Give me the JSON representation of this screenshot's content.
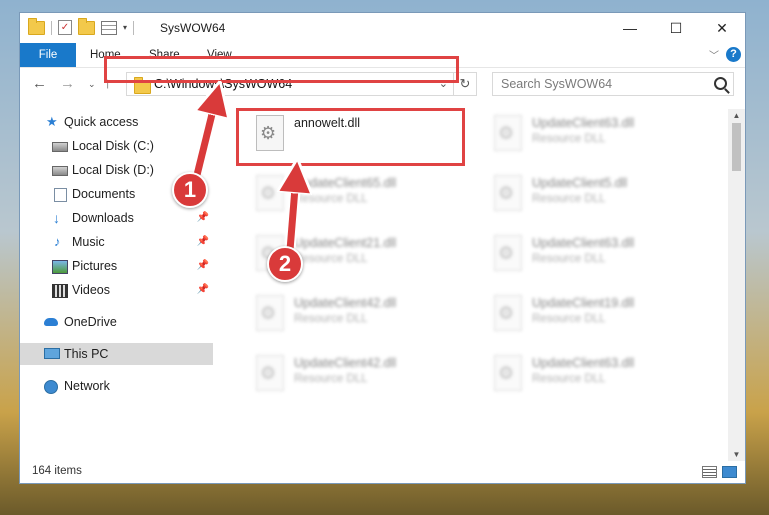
{
  "window": {
    "title": "SysWOW64",
    "controls": {
      "minimize": "—",
      "maximize": "☐",
      "close": "✕"
    }
  },
  "ribbon": {
    "tabs": [
      {
        "label": "File"
      },
      {
        "label": "Home"
      },
      {
        "label": "Share"
      },
      {
        "label": "View"
      }
    ],
    "help": "?"
  },
  "navigation": {
    "back": "←",
    "forward": "→",
    "recent": "⌄",
    "up": "↑",
    "address": "C:\\Windows\\SysWOW64",
    "address_dropdown": "⌄",
    "refresh": "↻",
    "search_placeholder": "Search SysWOW64"
  },
  "sidebar": {
    "items": [
      {
        "label": "Quick access",
        "icon": "star-icon"
      },
      {
        "label": "Local Disk (C:)",
        "icon": "disk-icon"
      },
      {
        "label": "Local Disk (D:)",
        "icon": "disk-icon"
      },
      {
        "label": "Documents",
        "icon": "documents-icon"
      },
      {
        "label": "Downloads",
        "icon": "downloads-icon",
        "pinned": true
      },
      {
        "label": "Music",
        "icon": "music-icon",
        "pinned": true
      },
      {
        "label": "Pictures",
        "icon": "pictures-icon",
        "pinned": true
      },
      {
        "label": "Videos",
        "icon": "videos-icon",
        "pinned": true
      },
      {
        "label": "OneDrive",
        "icon": "onedrive-icon"
      },
      {
        "label": "This PC",
        "icon": "pc-icon",
        "selected": true
      },
      {
        "label": "Network",
        "icon": "network-icon"
      }
    ],
    "pin_glyph": "📌"
  },
  "files": {
    "highlighted": {
      "name": "annowelt.dll",
      "type": ""
    },
    "items": [
      {
        "name": "UpdateClient63.dll",
        "type": "Resource DLL"
      },
      {
        "name": "UpdateClient65.dll",
        "type": "Resource DLL"
      },
      {
        "name": "UpdateClient5.dll",
        "type": "Resource DLL"
      },
      {
        "name": "UpdateClient21.dll",
        "type": "Resource DLL"
      },
      {
        "name": "UpdateClient63.dll",
        "type": "Resource DLL"
      },
      {
        "name": "UpdateClient42.dll",
        "type": "Resource DLL"
      },
      {
        "name": "UpdateClient19.dll",
        "type": "Resource DLL"
      },
      {
        "name": "UpdateClient42.dll",
        "type": "Resource DLL"
      },
      {
        "name": "UpdateClient63.dll",
        "type": "Resource DLL"
      }
    ]
  },
  "status": {
    "item_count": "164 items"
  },
  "callouts": {
    "one": "1",
    "two": "2"
  },
  "colors": {
    "accent": "#1979ca",
    "highlight": "#e04343",
    "callout": "#d93a3a"
  }
}
